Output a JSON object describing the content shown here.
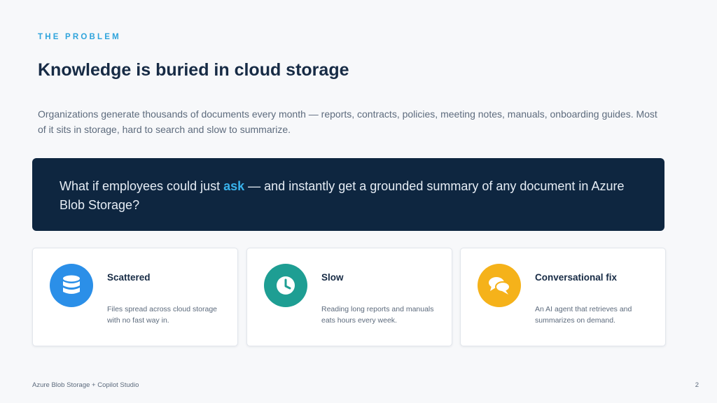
{
  "eyebrow": "THE PROBLEM",
  "title": "Knowledge is buried in cloud storage",
  "intro": "Organizations generate thousands of documents every month — reports, contracts, policies, meeting notes, manuals, onboarding guides. Most of it sits in storage, hard to search and slow to summarize.",
  "callout": {
    "before": "What if employees could just ",
    "accent": "ask",
    "after": " — and instantly get a grounded summary of any document in Azure Blob Storage?"
  },
  "cards": [
    {
      "title": "Scattered",
      "text": "Files spread across cloud storage with no fast way in.",
      "icon": "database-icon",
      "color": "#2b8fe8"
    },
    {
      "title": "Slow",
      "text": "Reading long reports and manuals eats hours every week.",
      "icon": "clock-icon",
      "color": "#1e9e93"
    },
    {
      "title": "Conversational fix",
      "text": "An AI agent that retrieves and summarizes on demand.",
      "icon": "chat-bubbles-icon",
      "color": "#f5b21a"
    }
  ],
  "footer": {
    "left": "Azure Blob Storage + Copilot Studio",
    "page_number": "2"
  },
  "colors": {
    "background": "#f7f8fa",
    "accent": "#2fa4dc",
    "callout_bg": "#0e2640",
    "heading": "#172b45"
  }
}
